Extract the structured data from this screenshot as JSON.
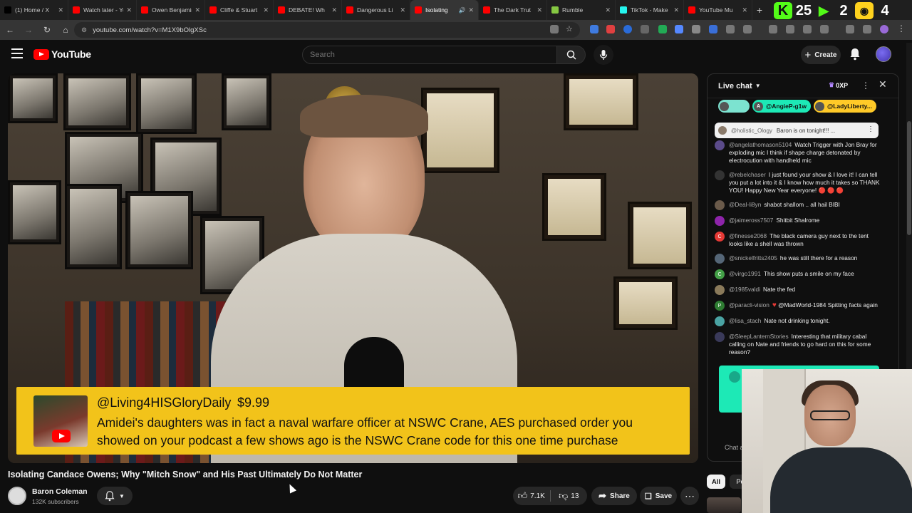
{
  "browser": {
    "tabs": [
      {
        "label": "(1) Home / X",
        "favicon": "x-icon",
        "color": "#000000"
      },
      {
        "label": "Watch later - YouTube",
        "favicon": "youtube-icon",
        "color": "#ff0000"
      },
      {
        "label": "Owen Benjamin",
        "favicon": "youtube-icon",
        "color": "#ff0000"
      },
      {
        "label": "Cliffe & Stuart",
        "favicon": "youtube-icon",
        "color": "#ff0000"
      },
      {
        "label": "DEBATE! Wh",
        "favicon": "youtube-icon",
        "color": "#ff0000"
      },
      {
        "label": "Dangerous Li",
        "favicon": "youtube-icon",
        "color": "#ff0000"
      },
      {
        "label": "Isolating",
        "favicon": "youtube-icon",
        "color": "#ff0000",
        "active": true
      },
      {
        "label": "The Dark Trut",
        "favicon": "youtube-icon",
        "color": "#ff0000"
      },
      {
        "label": "Rumble",
        "favicon": "rumble-icon",
        "color": "#85c742"
      },
      {
        "label": "TikTok - Make",
        "favicon": "tiktok-icon",
        "color": "#25f4ee"
      },
      {
        "label": "YouTube Mu",
        "favicon": "youtube-icon",
        "color": "#ff0000"
      }
    ],
    "url": "youtube.com/watch?v=M1X9bOlgXSc",
    "hud": {
      "kick_label": "K",
      "count_a": "25",
      "count_b": "2",
      "count_c": "4"
    }
  },
  "header": {
    "logo_text": "YouTube",
    "search_placeholder": "Search",
    "create_label": "Create"
  },
  "superchat": {
    "name": "@Living4HISGloryDaily",
    "amount": "$9.99",
    "message": "Amidei's daughters was in fact a naval warfare officer at NSWC Crane, AES purchased order you showed on your podcast a few shows ago is the NSWC Crane code for this one time purchase",
    "color": "#f2c31a"
  },
  "video": {
    "title": "Isolating Candace Owens; Why \"Mitch Snow\" and His Past Ultimately Do Not Matter",
    "channel": "Baron Coleman",
    "subscribers": "132K subscribers",
    "likes": "7.1K",
    "dislikes": "13",
    "share_label": "Share",
    "save_label": "Save"
  },
  "chat": {
    "title": "Live chat",
    "points": "0XP",
    "ticker": [
      {
        "label": "",
        "color": "#7ce3d0"
      },
      {
        "label": "@AngieP-g1w",
        "color": "#1de9b6",
        "initial": "A"
      },
      {
        "label": "@LadyLiberty...",
        "color": "#ffca28"
      }
    ],
    "pinned": {
      "author": "@holistic_Ology",
      "text": "Baron is on tonight!!! ..."
    },
    "messages": [
      {
        "author": "@angelathomason5104",
        "text": "Watch Trigger with Jon Bray for exploding mic I think if shape charge detonated by electrocution with handheld mic",
        "avatar_color": "#5b4b8a",
        "initial": ""
      },
      {
        "author": "@rebelchaser",
        "text": "I just found your show & I love it! I can tell you put a lot into it & I know how much it takes so THANK YOU! Happy New Year everyone! 🔴 🔴 🔴",
        "avatar_color": "#333333",
        "initial": ""
      },
      {
        "author": "@Deal-li8yn",
        "text": "shabot shallom .. all hail BIBI",
        "avatar_color": "#6a5a4a",
        "initial": ""
      },
      {
        "author": "@jaimeross7507",
        "text": "Shitbit Shalrome",
        "avatar_color": "#8e24aa",
        "initial": ""
      },
      {
        "author": "@finesse2068",
        "text": "The black camera guy next to the tent looks like a shell was thrown",
        "avatar_color": "#e53935",
        "initial": "C"
      },
      {
        "author": "@snickelfritts2405",
        "text": "he was still there for a reason",
        "avatar_color": "#556677",
        "initial": ""
      },
      {
        "author": "@virgo1991",
        "text": "This show puts a smile on my face",
        "avatar_color": "#43a047",
        "initial": "C"
      },
      {
        "author": "@1985valdi",
        "text": "Nate the fed",
        "avatar_color": "#8a7a5a",
        "initial": ""
      },
      {
        "author": "@paracli-vision",
        "text": "@MadWorld-1984 Spitting facts again",
        "avatar_color": "#2e7d32",
        "initial": "P",
        "heart": "♥"
      },
      {
        "author": "@lisa_stach",
        "text": "Nate not drinking tonight.",
        "avatar_color": "#4aa3a3",
        "initial": ""
      },
      {
        "author": "@SleepLanternStories",
        "text": "Interesting that military cabal calling on Nate and friends to go hard on this for some reason?",
        "avatar_color": "#3a3a5a",
        "initial": ""
      }
    ],
    "input_placeholder": "Chat a"
  },
  "chips": {
    "all": "All",
    "second": "Po"
  }
}
